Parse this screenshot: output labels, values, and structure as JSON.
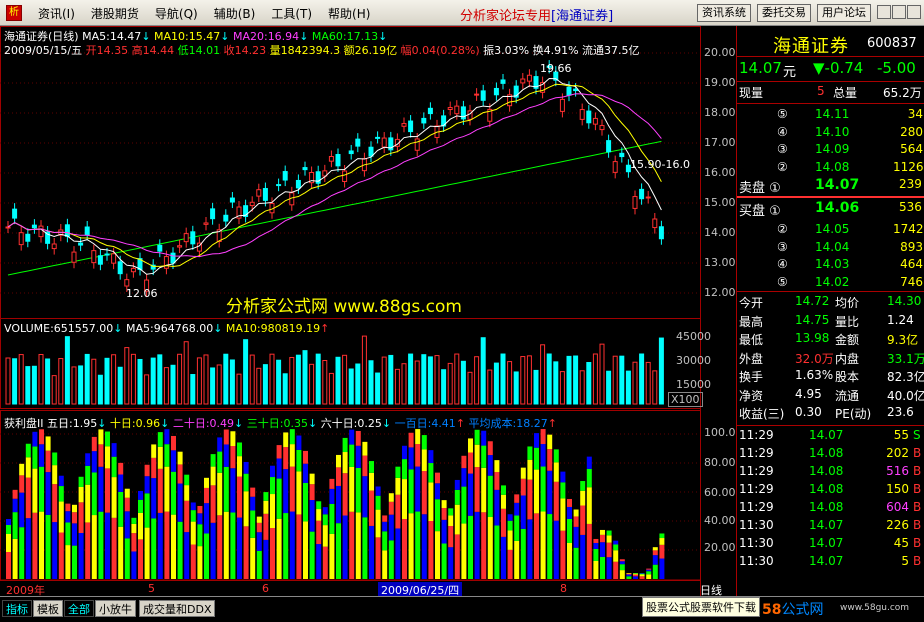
{
  "menu": {
    "app_icon": "析",
    "items": [
      "资讯(I)",
      "港股期货",
      "导航(Q)",
      "辅助(B)",
      "工具(T)",
      "帮助(H)"
    ],
    "title": "分析家论坛专用",
    "title_tag": "[海通证券]",
    "buttons": [
      "资讯系统",
      "委托交易",
      "用户论坛"
    ]
  },
  "chart_header": {
    "stock_label": "海通证券(日线)",
    "ma5": "MA5:14.47",
    "ma10": "MA10:15.47",
    "ma20": "MA20:16.94",
    "ma60": "MA60:17.13",
    "date": "2009/05/15/五",
    "open": "开14.35",
    "high": "高14.44",
    "low": "低14.01",
    "close": "收14.23",
    "volume_txt": "量1842394.3",
    "amount": "额26.19亿",
    "change": "幅0.04(0.28%)",
    "amplitude": "振3.03%",
    "turnover": "换4.91%",
    "float_cap": "流通37.5亿"
  },
  "annotations": {
    "peak": "19.66",
    "low": "12.06",
    "range": "15.90-16.0",
    "watermark": "分析家公式网 www.88gs.com"
  },
  "price_axis": [
    "20.00",
    "19.00",
    "18.00",
    "17.00",
    "16.00",
    "15.00",
    "14.00",
    "13.00",
    "12.00"
  ],
  "volume_header": {
    "volume": "VOLUME:651557.00",
    "ma5": "MA5:964768.00",
    "ma10": "MA10:980819.19"
  },
  "volume_axis": [
    "45000",
    "30000",
    "15000"
  ],
  "volume_unit": "X100",
  "indicator_header": {
    "name": "获利盘II",
    "d5": "五日:1.95",
    "d10": "十日:0.96",
    "d20": "二十日:0.49",
    "d30": "三十日:0.35",
    "d60": "六十日:0.25",
    "d100": "一百日:4.41",
    "avg_cost": "平均成本:18.27"
  },
  "indicator_axis": [
    "100.0",
    "80.00",
    "60.00",
    "40.00",
    "20.00"
  ],
  "date_axis": {
    "start": "2009年",
    "m5": "5",
    "m6": "6",
    "cursor": "2009/06/25/四",
    "m8": "8",
    "unit": "日线"
  },
  "quote": {
    "name": "海通证券",
    "code": "600837",
    "price": "14.07",
    "price_unit": "元",
    "change": "▼-0.74",
    "change_pct": "-5.00",
    "now_vol_label": "现量",
    "now_vol": "5",
    "total_vol_label": "总量",
    "total_vol": "65.2万",
    "asks": [
      {
        "level": "⑤",
        "price": "14.11",
        "vol": "34"
      },
      {
        "level": "④",
        "price": "14.10",
        "vol": "280"
      },
      {
        "level": "③",
        "price": "14.09",
        "vol": "564"
      },
      {
        "level": "②",
        "price": "14.08",
        "vol": "1126"
      }
    ],
    "ask1": {
      "label": "卖盘 ①",
      "price": "14.07",
      "vol": "239"
    },
    "bid1": {
      "label": "买盘 ①",
      "price": "14.06",
      "vol": "536"
    },
    "bids": [
      {
        "level": "②",
        "price": "14.05",
        "vol": "1742"
      },
      {
        "level": "③",
        "price": "14.04",
        "vol": "893"
      },
      {
        "level": "④",
        "price": "14.03",
        "vol": "464"
      },
      {
        "level": "⑤",
        "price": "14.02",
        "vol": "746"
      }
    ],
    "stats": [
      {
        "l1": "今开",
        "v1": "14.72",
        "l2": "均价",
        "v2": "14.30",
        "c1": "#00ff00",
        "c2": "#00ff00"
      },
      {
        "l1": "最高",
        "v1": "14.75",
        "l2": "量比",
        "v2": "1.24",
        "c1": "#00ff00",
        "c2": "#ffffff"
      },
      {
        "l1": "最低",
        "v1": "13.98",
        "l2": "金额",
        "v2": "9.3亿",
        "c1": "#00ff00",
        "c2": "#ffff00"
      },
      {
        "l1": "外盘",
        "v1": "32.0万",
        "l2": "内盘",
        "v2": "33.1万",
        "c1": "#ff3030",
        "c2": "#00ff00"
      },
      {
        "l1": "换手",
        "v1": "1.63%",
        "l2": "股本",
        "v2": "82.3亿",
        "c1": "#ffffff",
        "c2": "#ffffff"
      },
      {
        "l1": "净资",
        "v1": "4.95",
        "l2": "流通",
        "v2": "40.0亿",
        "c1": "#ffffff",
        "c2": "#ffffff"
      },
      {
        "l1": "收益(三)",
        "v1": "0.30",
        "l2": "PE(动)",
        "v2": "23.6",
        "c1": "#ffffff",
        "c2": "#ffffff"
      }
    ],
    "ticks": [
      {
        "time": "11:29",
        "price": "14.07",
        "vol": "55",
        "side": "S",
        "vc": "#ffff00"
      },
      {
        "time": "11:29",
        "price": "14.08",
        "vol": "202",
        "side": "B",
        "vc": "#ffff00"
      },
      {
        "time": "11:29",
        "price": "14.08",
        "vol": "516",
        "side": "B",
        "vc": "#ff40ff"
      },
      {
        "time": "11:29",
        "price": "14.08",
        "vol": "150",
        "side": "B",
        "vc": "#ffff00"
      },
      {
        "time": "11:29",
        "price": "14.08",
        "vol": "604",
        "side": "B",
        "vc": "#ff40ff"
      },
      {
        "time": "11:30",
        "price": "14.07",
        "vol": "226",
        "side": "B",
        "vc": "#ffff00"
      },
      {
        "time": "11:30",
        "price": "14.07",
        "vol": "45",
        "side": "B",
        "vc": "#ffff00"
      },
      {
        "time": "11:30",
        "price": "14.07",
        "vol": "5",
        "side": "B",
        "vc": "#ffff00"
      }
    ]
  },
  "tabs": [
    "指标",
    "模板",
    "全部",
    "小放牛",
    "成交量和DDX"
  ],
  "promo": "股票公式股票软件下载",
  "site": {
    "prefix": "58",
    "suffix": "公式网",
    "url": "www.58gu.com"
  },
  "colors": {
    "up": "#ff3030",
    "down": "#00ffff",
    "ma5": "#ffffff",
    "ma10": "#ffff00",
    "ma20": "#ff40ff",
    "ma60": "#00ff00",
    "grid": "#a00000"
  }
}
